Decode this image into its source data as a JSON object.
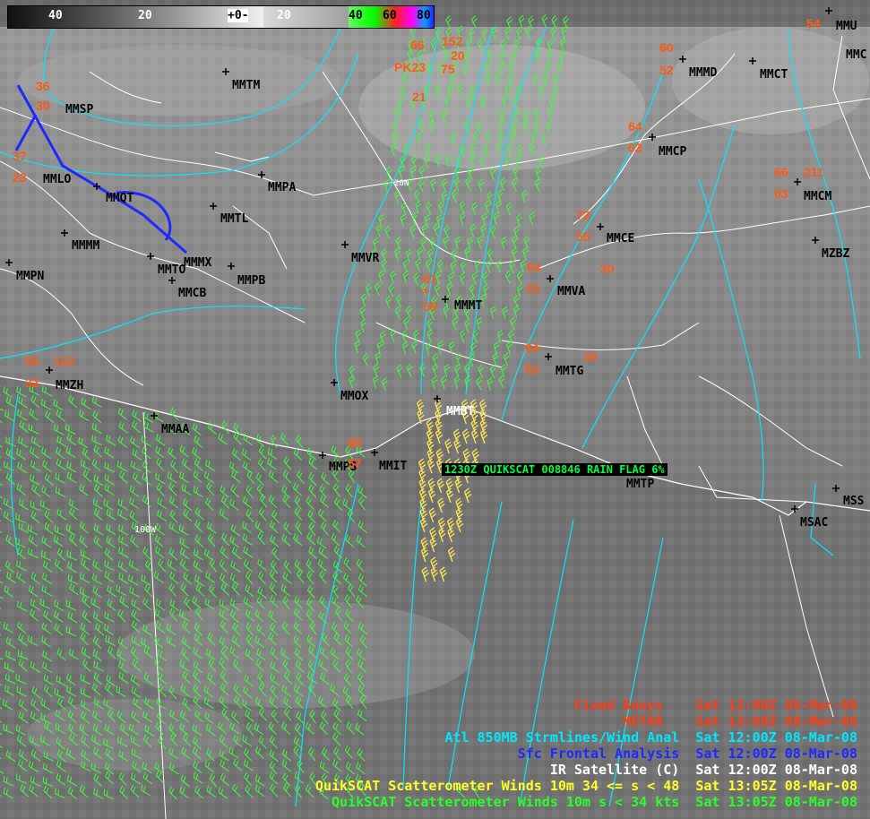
{
  "colorbar": {
    "labels": [
      "40",
      "20",
      "+0-",
      "20",
      "40",
      "60",
      "80"
    ]
  },
  "qs_label": "1230Z QUIKSCAT 008846 RAIN FLAG 6%",
  "grid_labels": {
    "lat_20n": "20N",
    "lon_100w": "100W"
  },
  "stations": [
    {
      "id": "MMTM",
      "text": "MMTM"
    },
    {
      "id": "MMSP",
      "text": "MMSP"
    },
    {
      "id": "MMLO",
      "text": "MMLO"
    },
    {
      "id": "MMQT",
      "text": "MMQT"
    },
    {
      "id": "MMPA",
      "text": "MMPA"
    },
    {
      "id": "MMTL",
      "text": "MMTL"
    },
    {
      "id": "MMMM",
      "text": "MMMM"
    },
    {
      "id": "MMMX",
      "text": "MMMX"
    },
    {
      "id": "MMTO",
      "text": "MMTO"
    },
    {
      "id": "MMPB",
      "text": "MMPB"
    },
    {
      "id": "MMCB",
      "text": "MMCB"
    },
    {
      "id": "MMPN",
      "text": "MMPN"
    },
    {
      "id": "MMVR",
      "text": "MMVR"
    },
    {
      "id": "MMMT",
      "text": "MMMT"
    },
    {
      "id": "MMVA",
      "text": "MMVA"
    },
    {
      "id": "MMCE",
      "text": "MMCE"
    },
    {
      "id": "MMCP",
      "text": "MMCP"
    },
    {
      "id": "MMMD",
      "text": "MMMD"
    },
    {
      "id": "MMCT",
      "text": "MMCT"
    },
    {
      "id": "MMCM",
      "text": "MMCM"
    },
    {
      "id": "MZBZ",
      "text": "MZBZ"
    },
    {
      "id": "MMUN",
      "text": "MMU"
    },
    {
      "id": "MMCZ",
      "text": "MMC"
    },
    {
      "id": "MMTG",
      "text": "MMTG"
    },
    {
      "id": "MMZH",
      "text": "MMZH"
    },
    {
      "id": "MMOX",
      "text": "MMOX"
    },
    {
      "id": "MMAA",
      "text": "MMAA"
    },
    {
      "id": "MMBT",
      "text": "MMBT"
    },
    {
      "id": "MMPS",
      "text": "MMPS"
    },
    {
      "id": "MMIT",
      "text": "MMIT"
    },
    {
      "id": "MMTP",
      "text": "MMTP"
    },
    {
      "id": "MSSS",
      "text": "MSS"
    },
    {
      "id": "MSAC",
      "text": "MSAC"
    }
  ],
  "observations": [
    {
      "id": "obs-mmsp-t",
      "text": "36"
    },
    {
      "id": "obs-mmsp-d",
      "text": "30"
    },
    {
      "id": "obs-mmlo-t",
      "text": "37"
    },
    {
      "id": "obs-mmlo-d",
      "text": "23"
    },
    {
      "id": "obs-pk-1",
      "text": "66"
    },
    {
      "id": "obs-pk-2",
      "text": "152"
    },
    {
      "id": "obs-pk-3",
      "text": "PK23"
    },
    {
      "id": "obs-pk-4",
      "text": "20"
    },
    {
      "id": "obs-pk-5",
      "text": "75"
    },
    {
      "id": "obs-pk-6",
      "text": "21"
    },
    {
      "id": "obs-mmmd-t",
      "text": "60"
    },
    {
      "id": "obs-mmmd-d",
      "text": "52"
    },
    {
      "id": "obs-mmcp-t",
      "text": "64"
    },
    {
      "id": "obs-mmcp-d",
      "text": "63"
    },
    {
      "id": "obs-mmcm-t",
      "text": "66"
    },
    {
      "id": "obs-mmcm-p",
      "text": "211"
    },
    {
      "id": "obs-mmcm-d",
      "text": "63"
    },
    {
      "id": "obs-mmce-t",
      "text": "72"
    },
    {
      "id": "obs-mmce-d",
      "text": "55"
    },
    {
      "id": "obs-mmce-v",
      "text": "30"
    },
    {
      "id": "obs-mmva-t",
      "text": "64"
    },
    {
      "id": "obs-mmva-d",
      "text": "61"
    },
    {
      "id": "obs-mmmt-t",
      "text": "61"
    },
    {
      "id": "obs-mmmt-w",
      "text": "∞"
    },
    {
      "id": "obs-mmmt-d",
      "text": "59"
    },
    {
      "id": "obs-mmtg-t",
      "text": "64"
    },
    {
      "id": "obs-mmtg-d",
      "text": "52"
    },
    {
      "id": "obs-mmtg-v",
      "text": "30"
    },
    {
      "id": "obs-mmzh-t",
      "text": "55"
    },
    {
      "id": "obs-mmzh-p",
      "text": "122"
    },
    {
      "id": "obs-mmzh-d",
      "text": "32"
    },
    {
      "id": "obs-mmps-t",
      "text": "68"
    },
    {
      "id": "obs-mmps-d",
      "text": "57"
    },
    {
      "id": "obs-ne-t",
      "text": "54"
    }
  ],
  "legend": [
    {
      "name": "Fixed Buoys",
      "time": "Sat 12:00Z 08-Mar-08",
      "color": "#ff3c14"
    },
    {
      "name": "METAR",
      "time": "Sat 13:00Z 08-Mar-08",
      "color": "#ff3c14"
    },
    {
      "name": "Atl 850MB Strmlines/Wind Anal",
      "time": "Sat 12:00Z 08-Mar-08",
      "color": "#00e8ff"
    },
    {
      "name": "Sfc Frontal Analysis",
      "time": "Sat 12:00Z 08-Mar-08",
      "color": "#1e28ff"
    },
    {
      "name": "IR Satellite (C)",
      "time": "Sat 12:00Z 08-Mar-08",
      "color": "#ffffff"
    },
    {
      "name": "QuikSCAT Scatterometer Winds 10m 34 <= s < 48",
      "time": "Sat 13:05Z 08-Mar-08",
      "color": "#ffff28"
    },
    {
      "name": "QuikSCAT Scatterometer Winds 10m s < 34 kts",
      "time": "Sat 13:05Z 08-Mar-08",
      "color": "#28ff28"
    }
  ],
  "colors": {
    "metar": "#ff5a14",
    "streamline": "#00e8ff",
    "front": "#1e28ff",
    "barb_green": "#3cff3c",
    "barb_yellow": "#ffe650",
    "borders": "#ffffff"
  }
}
